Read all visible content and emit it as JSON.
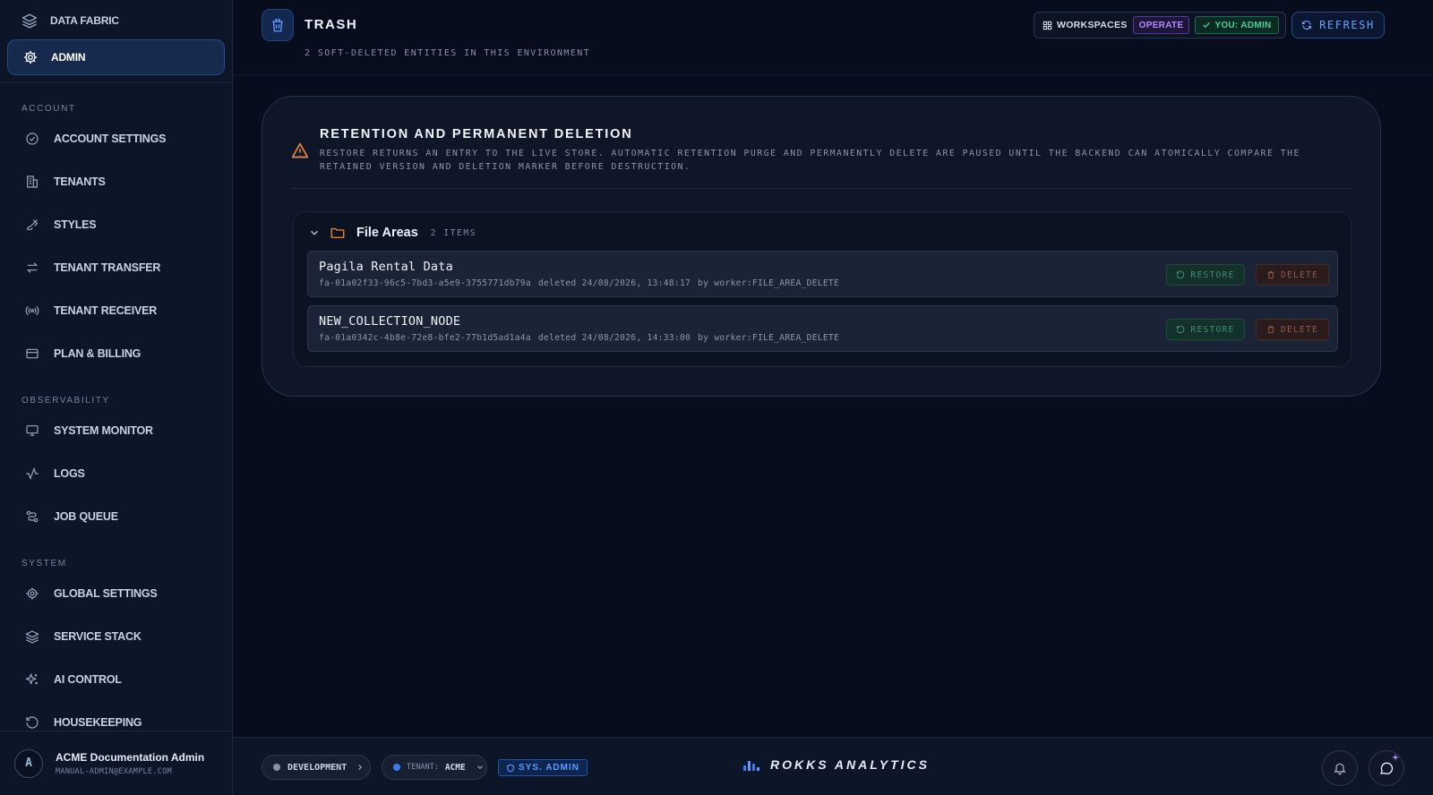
{
  "sidebar": {
    "top": [
      {
        "label": "DATA FABRIC",
        "icon": "layers-icon"
      },
      {
        "label": "ADMIN",
        "icon": "gear-icon"
      }
    ],
    "sections": [
      {
        "label": "ACCOUNT",
        "items": [
          {
            "label": "ACCOUNT SETTINGS",
            "icon": "check-circle-icon"
          },
          {
            "label": "TENANTS",
            "icon": "building-icon"
          },
          {
            "label": "STYLES",
            "icon": "brush-icon"
          },
          {
            "label": "TENANT TRANSFER",
            "icon": "transfer-arrows-icon"
          },
          {
            "label": "TENANT RECEIVER",
            "icon": "broadcast-icon"
          },
          {
            "label": "PLAN & BILLING",
            "icon": "credit-card-icon"
          }
        ]
      },
      {
        "label": "OBSERVABILITY",
        "items": [
          {
            "label": "SYSTEM MONITOR",
            "icon": "monitor-icon"
          },
          {
            "label": "LOGS",
            "icon": "activity-icon"
          },
          {
            "label": "JOB QUEUE",
            "icon": "workflow-icon"
          }
        ]
      },
      {
        "label": "SYSTEM",
        "items": [
          {
            "label": "GLOBAL SETTINGS",
            "icon": "gear-icon"
          },
          {
            "label": "SERVICE STACK",
            "icon": "layers-icon"
          },
          {
            "label": "AI CONTROL",
            "icon": "sparkles-icon"
          },
          {
            "label": "HOUSEKEEPING",
            "icon": "history-icon"
          }
        ]
      }
    ],
    "user": {
      "initial": "A",
      "name": "ACME Documentation Admin",
      "email": "MANUAL-ADMIN@EXAMPLE.COM"
    }
  },
  "header": {
    "title": "TRASH",
    "subtitle": "2 SOFT-DELETED ENTITIES IN THIS ENVIRONMENT",
    "workspaces_label": "WORKSPACES",
    "operate_badge": "OPERATE",
    "role_badge": "YOU: ADMIN",
    "refresh_label": "REFRESH"
  },
  "retention": {
    "title": "RETENTION AND PERMANENT DELETION",
    "body": "RESTORE RETURNS AN ENTRY TO THE LIVE STORE. AUTOMATIC RETENTION PURGE AND PERMANENTLY DELETE ARE PAUSED UNTIL THE BACKEND CAN ATOMICALLY COMPARE THE RETAINED VERSION AND DELETION MARKER BEFORE DESTRUCTION."
  },
  "group": {
    "title": "File Areas",
    "count": "2 ITEMS",
    "entries": [
      {
        "name": "Pagila Rental Data",
        "id": "fa-01a02f33-96c5-7bd3-a5e9-3755771db79a",
        "deleted": "deleted 24/08/2026, 13:48:17",
        "by": "by worker:FILE_AREA_DELETE",
        "restore": "RESTORE",
        "delete": "DELETE"
      },
      {
        "name": "NEW_COLLECTION_NODE",
        "id": "fa-01a0342c-4b8e-72e8-bfe2-77b1d5ad1a4a",
        "deleted": "deleted 24/08/2026, 14:33:00",
        "by": "by worker:FILE_AREA_DELETE",
        "restore": "RESTORE",
        "delete": "DELETE"
      }
    ]
  },
  "footer": {
    "environment": "DEVELOPMENT",
    "tenant_label": "TENANT:",
    "tenant_value": "ACME",
    "sys_badge": "SYS. ADMIN",
    "brand": "ROKKS ANALYTICS"
  },
  "colors": {
    "accent": "#6aa0ff",
    "operate": "#b58cff",
    "success": "#42d39a",
    "warning": "#f08a3c"
  }
}
